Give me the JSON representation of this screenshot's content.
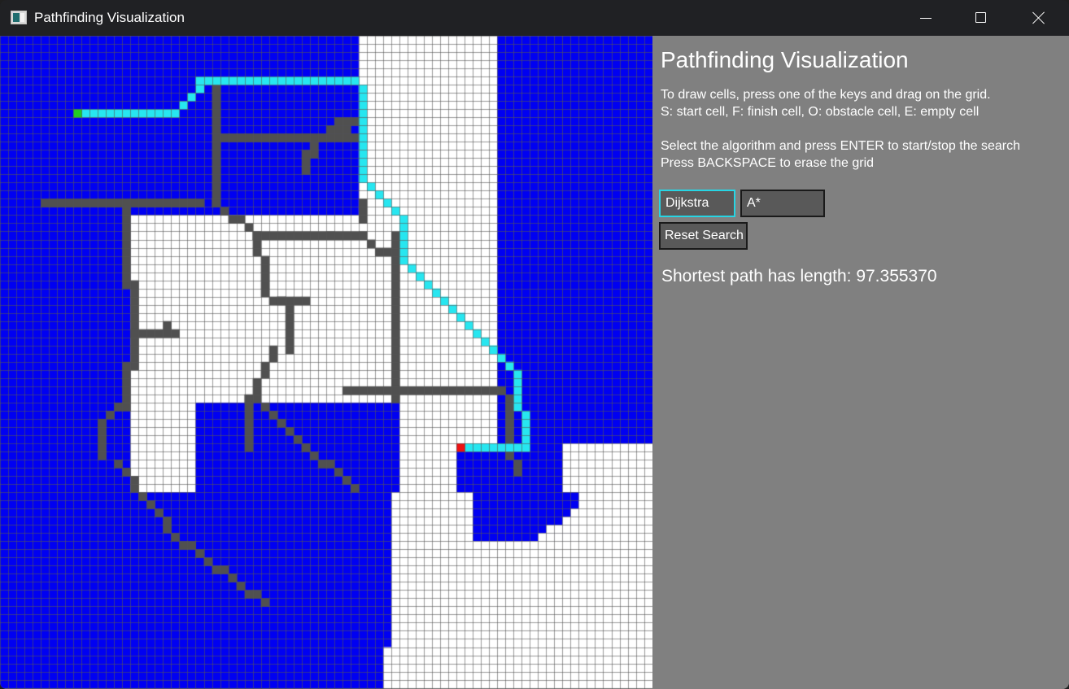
{
  "window": {
    "title": "Pathfinding Visualization",
    "controls": [
      "minimize-icon",
      "maximize-icon",
      "close-icon"
    ]
  },
  "panel": {
    "title": "Pathfinding Visualization",
    "instructions": [
      "To draw cells, press one of the keys and drag on the grid.",
      "S: start cell, F: finish cell, O: obstacle cell, E: empty cell",
      "Select the algorithm and press ENTER to start/stop the search",
      "Press BACKSPACE to erase the grid"
    ],
    "algorithms": {
      "dijkstra": "Dijkstra",
      "astar": "A*",
      "selected": "Dijkstra"
    },
    "reset_label": "Reset Search",
    "result": "Shortest path has length: 97.355370"
  },
  "grid": {
    "size": 80,
    "colors": {
      "visited": "#0000f2",
      "empty": "#ffffff",
      "obstacle": "#505050",
      "path": "#27e6f0",
      "start": "#22cc22",
      "finish": "#ee1111",
      "line": "#555555",
      "accent": "#27d5e4"
    },
    "start": [
      9,
      9
    ],
    "finish": [
      56,
      50
    ]
  }
}
